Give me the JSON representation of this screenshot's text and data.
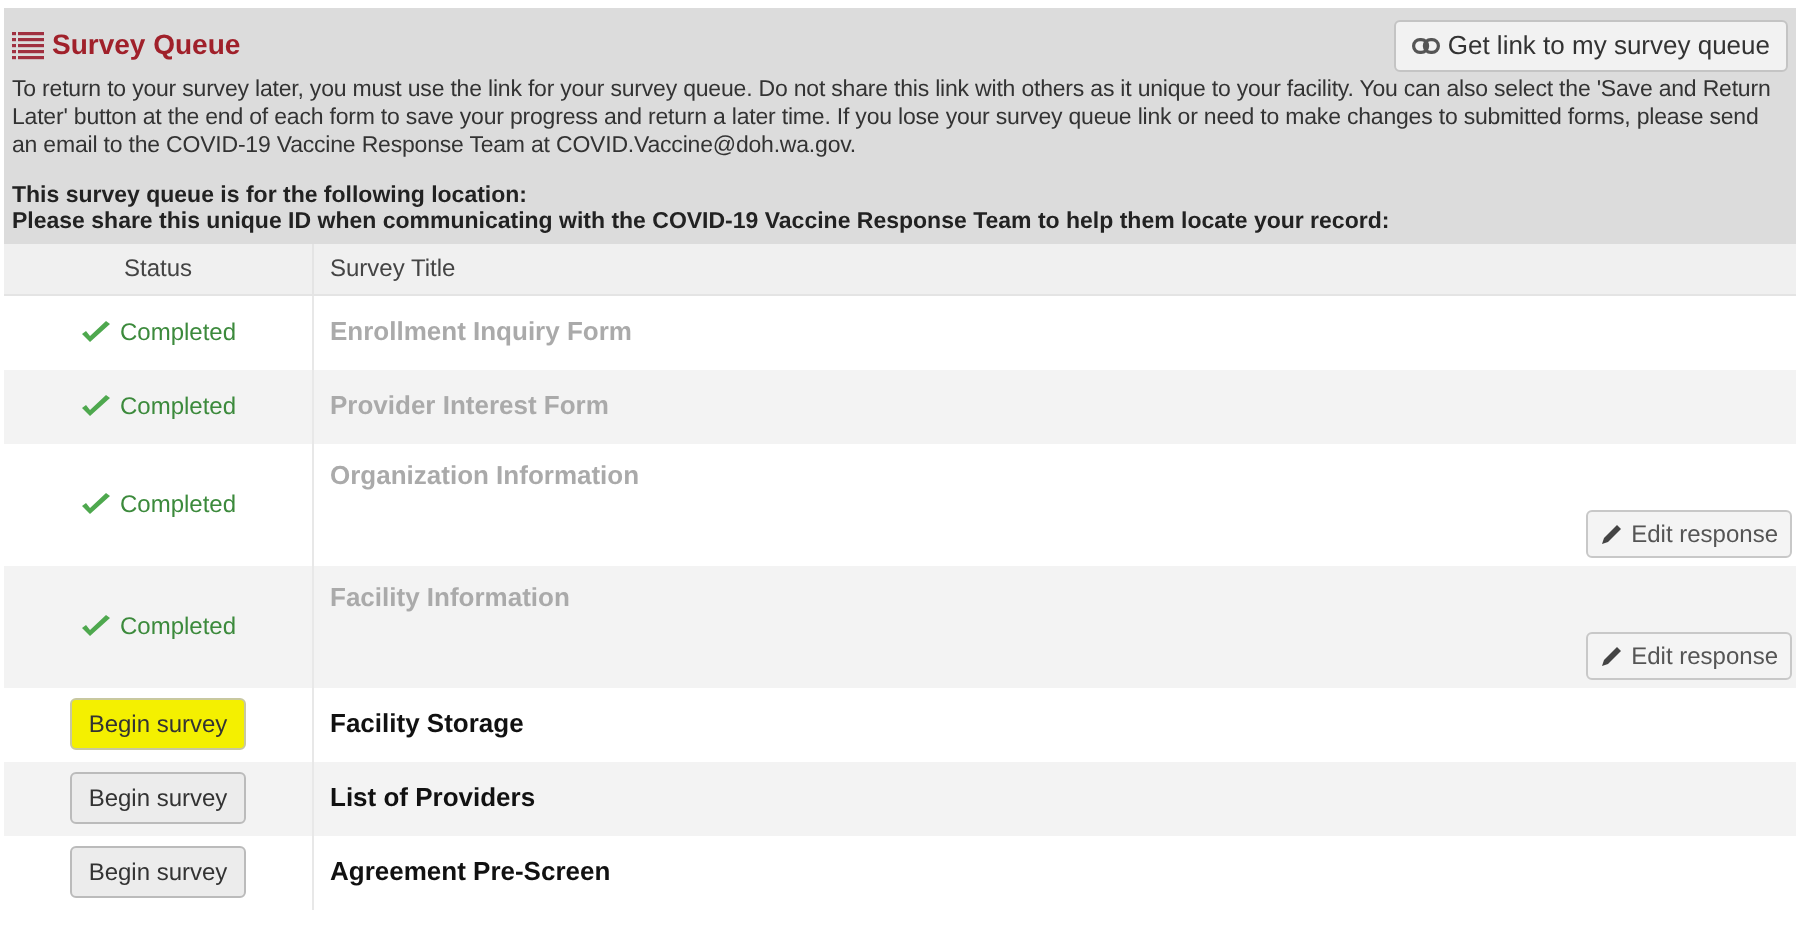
{
  "header": {
    "title": "Survey Queue",
    "link_button": "Get link to my survey queue",
    "intro": "To return to your survey later, you must use the link for your survey queue. Do not share this link with others as it unique to your facility. You can also select the 'Save and Return Later' button at the end of each form to save your progress and return a later time. If you lose your survey queue link or need to make changes to submitted forms, please send an email to the COVID-19 Vaccine Response Team at COVID.Vaccine@doh.wa.gov.",
    "location_lines": [
      "This survey queue is for the following location:",
      "Please share this unique ID when communicating with the COVID-19 Vaccine Response Team to help them locate your record:"
    ]
  },
  "table": {
    "columns": [
      "Status",
      "Survey Title"
    ],
    "rows": [
      {
        "kind": "completed",
        "status": "Completed",
        "title": "Enrollment Inquiry Form"
      },
      {
        "kind": "completed",
        "status": "Completed",
        "title": "Provider Interest Form"
      },
      {
        "kind": "completed",
        "status": "Completed",
        "title": "Organization Information",
        "edit_button": "Edit response"
      },
      {
        "kind": "completed",
        "status": "Completed",
        "title": "Facility Information",
        "edit_button": "Edit response"
      },
      {
        "kind": "pending",
        "status": "Begin survey",
        "title": "Facility Storage",
        "highlighted": true
      },
      {
        "kind": "pending",
        "status": "Begin survey",
        "title": "List of Providers",
        "highlighted": false
      },
      {
        "kind": "pending",
        "status": "Begin survey",
        "title": "Agreement Pre-Screen",
        "highlighted": false
      }
    ]
  }
}
